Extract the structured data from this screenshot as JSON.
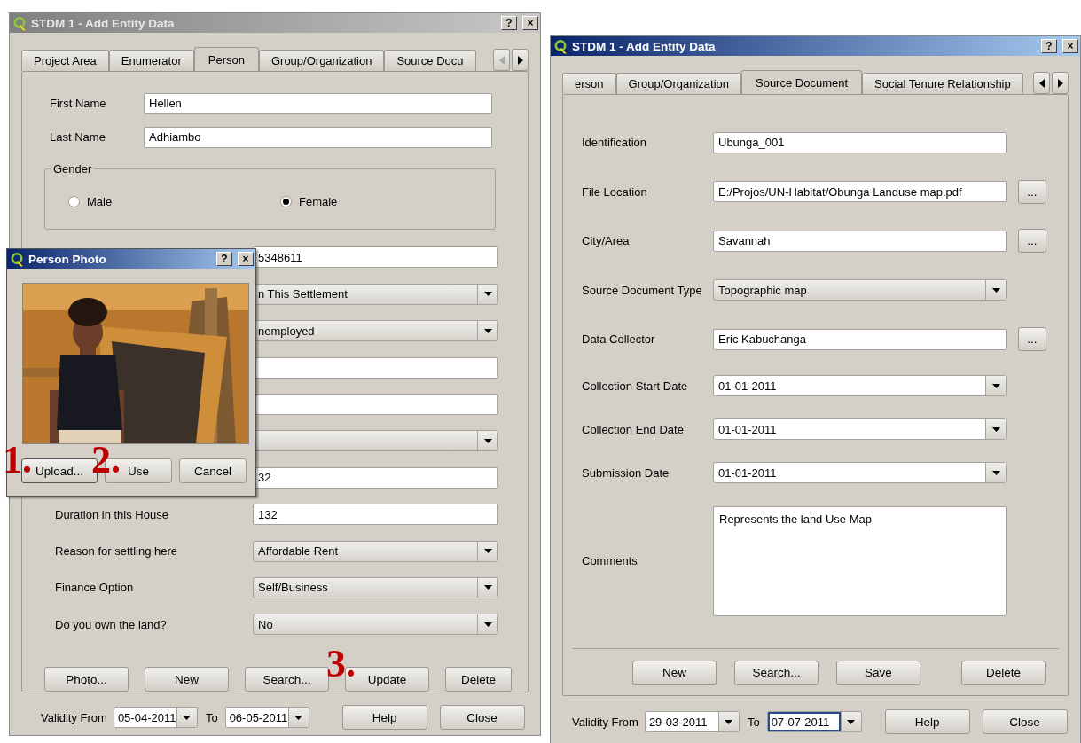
{
  "left_window": {
    "title": "STDM 1 - Add Entity Data",
    "active": false,
    "title_buttons": [
      "?",
      "×"
    ],
    "tabs": [
      {
        "label": "Project Area",
        "selected": false
      },
      {
        "label": "Enumerator",
        "selected": false
      },
      {
        "label": "Person",
        "selected": true
      },
      {
        "label": "Group/Organization",
        "selected": false
      },
      {
        "label": "Source Docu",
        "selected": false
      }
    ],
    "tab_scroll": {
      "left_disabled": true,
      "right_disabled": false
    },
    "name_fields": [
      {
        "label": "First Name",
        "value": "Hellen"
      },
      {
        "label": "Last Name",
        "value": "Adhiambo"
      }
    ],
    "gender": {
      "title": "Gender",
      "options": [
        {
          "label": "Male",
          "selected": false
        },
        {
          "label": "Female",
          "selected": true
        }
      ]
    },
    "fields": [
      {
        "kind": "text",
        "value": "5348611"
      },
      {
        "kind": "combo",
        "value": "n This Settlement"
      },
      {
        "kind": "combo",
        "value": "nemployed"
      },
      {
        "kind": "text"
      },
      {
        "kind": "text"
      },
      {
        "kind": "combo"
      },
      {
        "kind": "text",
        "value": "32"
      },
      {
        "kind": "text",
        "label": "Duration in this House",
        "value": "132"
      },
      {
        "kind": "combo",
        "label": "Reason for settling here",
        "value": "Affordable Rent"
      },
      {
        "kind": "combo",
        "label": "Finance Option",
        "value": "Self/Business"
      },
      {
        "kind": "combo",
        "label": "Do you own the land?",
        "value": "No"
      }
    ],
    "actions": [
      "Photo...",
      "New",
      "Search...",
      "Update",
      "Delete"
    ],
    "validity": {
      "from_label": "Validity From",
      "from": "05-04-2011",
      "to_label": "To",
      "to": "06-05-2011",
      "to_focused": false
    },
    "dialog_buttons": [
      "Help",
      "Close"
    ]
  },
  "right_window": {
    "title": "STDM 1 - Add Entity Data",
    "active": true,
    "title_buttons": [
      "?",
      "×"
    ],
    "tabs": [
      {
        "label": "erson",
        "selected": false
      },
      {
        "label": "Group/Organization",
        "selected": false
      },
      {
        "label": "Source Document",
        "selected": true
      },
      {
        "label": "Social Tenure Relationship",
        "selected": false
      }
    ],
    "tab_scroll": {
      "left_disabled": false,
      "right_disabled": false
    },
    "fields": [
      {
        "kind": "text",
        "label": "Identification",
        "value": "Ubunga_001"
      },
      {
        "kind": "text",
        "label": "File Location",
        "value": "E:/Projos/UN-Habitat/Obunga Landuse map.pdf",
        "browse": "..."
      },
      {
        "kind": "text",
        "label": "City/Area",
        "value": "Savannah",
        "browse": "..."
      },
      {
        "kind": "combo",
        "label": "Source Document Type",
        "value": "Topographic map"
      },
      {
        "kind": "text",
        "label": "Data Collector",
        "value": "Eric Kabuchanga",
        "browse": "..."
      },
      {
        "kind": "date",
        "label": "Collection Start Date",
        "value": "01-01-2011"
      },
      {
        "kind": "date",
        "label": "Collection End Date",
        "value": "01-01-2011"
      },
      {
        "kind": "date",
        "label": "Submission Date",
        "value": "01-01-2011"
      },
      {
        "kind": "textarea",
        "label": "Comments",
        "value": "Represents the land Use Map"
      }
    ],
    "actions": [
      "New",
      "Search...",
      "Save",
      "Delete"
    ],
    "validity": {
      "from_label": "Validity From",
      "from": "29-03-2011",
      "to_label": "To",
      "to": "07-07-2011",
      "to_focused": true
    },
    "dialog_buttons": [
      "Help",
      "Close"
    ]
  },
  "photo_dialog": {
    "title": "Person Photo",
    "active": true,
    "title_buttons": [
      "?",
      "×"
    ],
    "photo": {
      "kind": "picture"
    },
    "buttons": [
      "Upload...",
      "Use",
      "Cancel"
    ]
  },
  "annotations": [
    {
      "text": "1."
    },
    {
      "text": "2."
    },
    {
      "text": "3."
    }
  ]
}
